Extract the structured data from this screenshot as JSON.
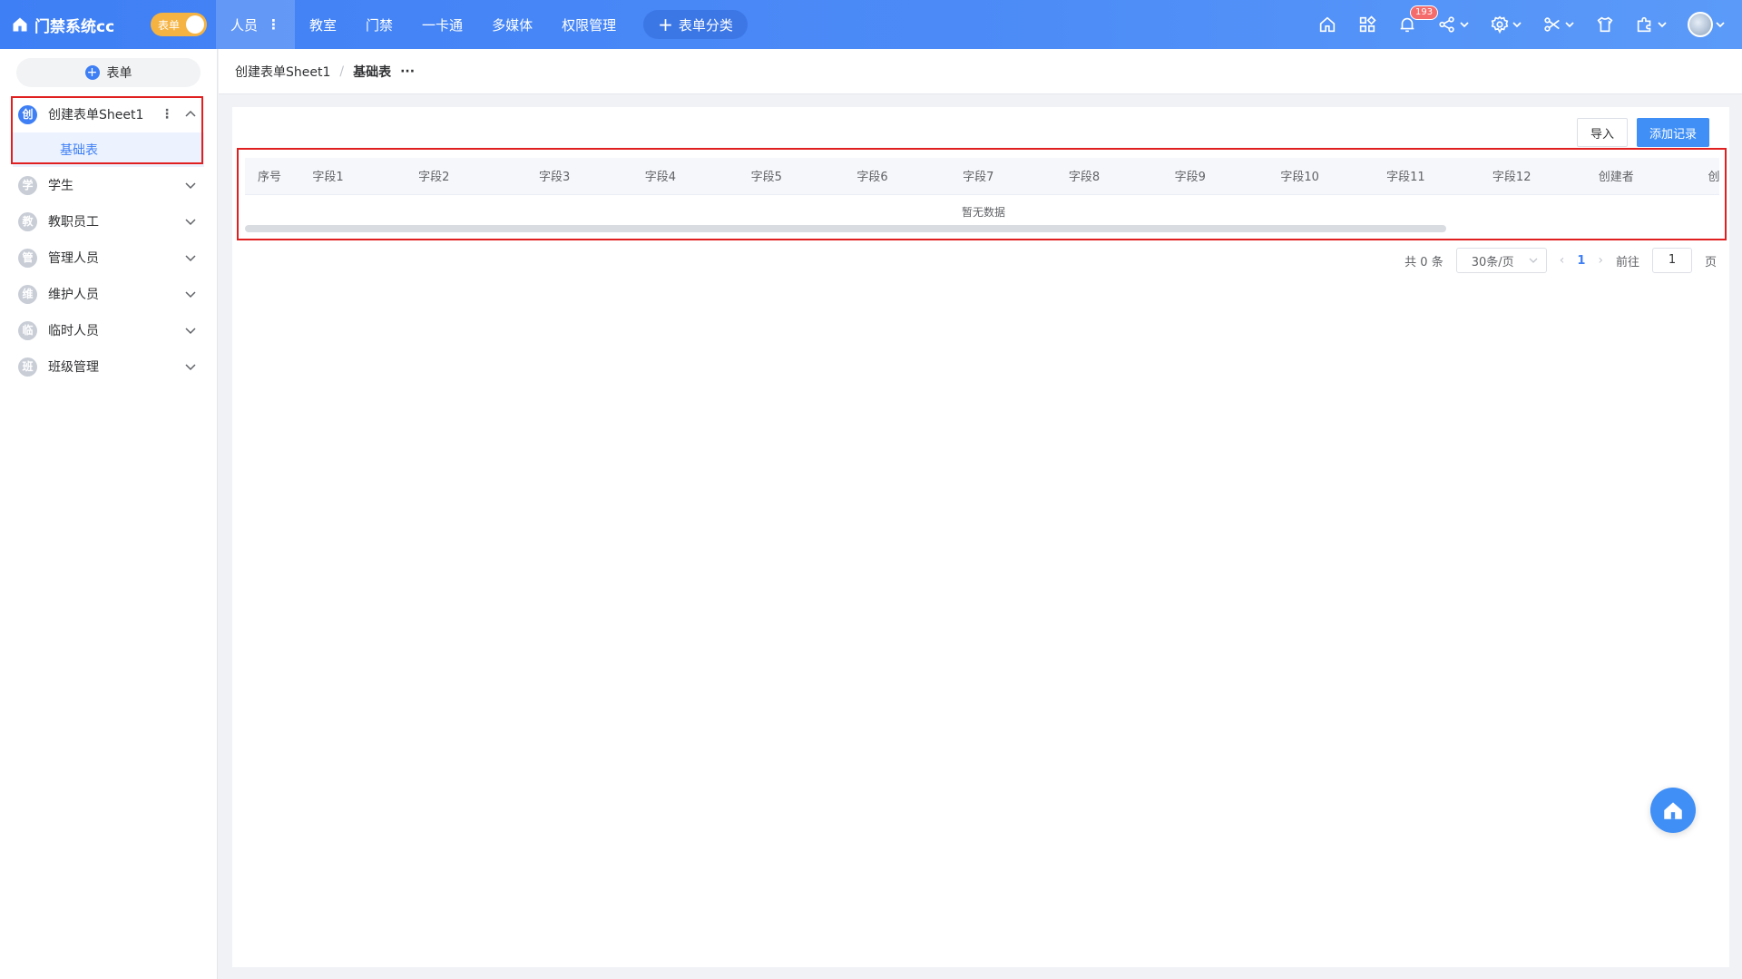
{
  "app": {
    "title": "门禁系统cc",
    "toggle_label": "表单"
  },
  "nav": {
    "items": [
      {
        "label": "人员",
        "active": true
      },
      {
        "label": "教室"
      },
      {
        "label": "门禁"
      },
      {
        "label": "一卡通"
      },
      {
        "label": "多媒体"
      },
      {
        "label": "权限管理"
      }
    ],
    "add_category": "表单分类",
    "notification_count": "193"
  },
  "sidebar": {
    "add_form": "表单",
    "active_group": {
      "icon": "创",
      "label": "创建表单Sheet1",
      "sub_label": "基础表"
    },
    "groups": [
      {
        "icon": "学",
        "label": "学生"
      },
      {
        "icon": "教",
        "label": "教职员工"
      },
      {
        "icon": "管",
        "label": "管理人员"
      },
      {
        "icon": "维",
        "label": "维护人员"
      },
      {
        "icon": "临",
        "label": "临时人员"
      },
      {
        "icon": "班",
        "label": "班级管理"
      }
    ]
  },
  "breadcrumb": {
    "parent": "创建表单Sheet1",
    "separator": "/",
    "current": "基础表",
    "more": "···"
  },
  "toolbar": {
    "import_label": "导入",
    "add_label": "添加记录"
  },
  "table": {
    "columns": [
      "序号",
      "字段1",
      "字段2",
      "字段3",
      "字段4",
      "字段5",
      "字段6",
      "字段7",
      "字段8",
      "字段9",
      "字段10",
      "字段11",
      "字段12",
      "创建者",
      "创建"
    ],
    "empty_text": "暂无数据"
  },
  "pagination": {
    "total": "共 0 条",
    "page_size": "30条/页",
    "current": "1",
    "goto_label": "前往",
    "goto_value": "1",
    "page_unit": "页"
  },
  "colors": {
    "primary": "#3f7ff5",
    "toggle": "#f5b342",
    "highlight": "#e02020",
    "badge": "#f56c6c"
  }
}
